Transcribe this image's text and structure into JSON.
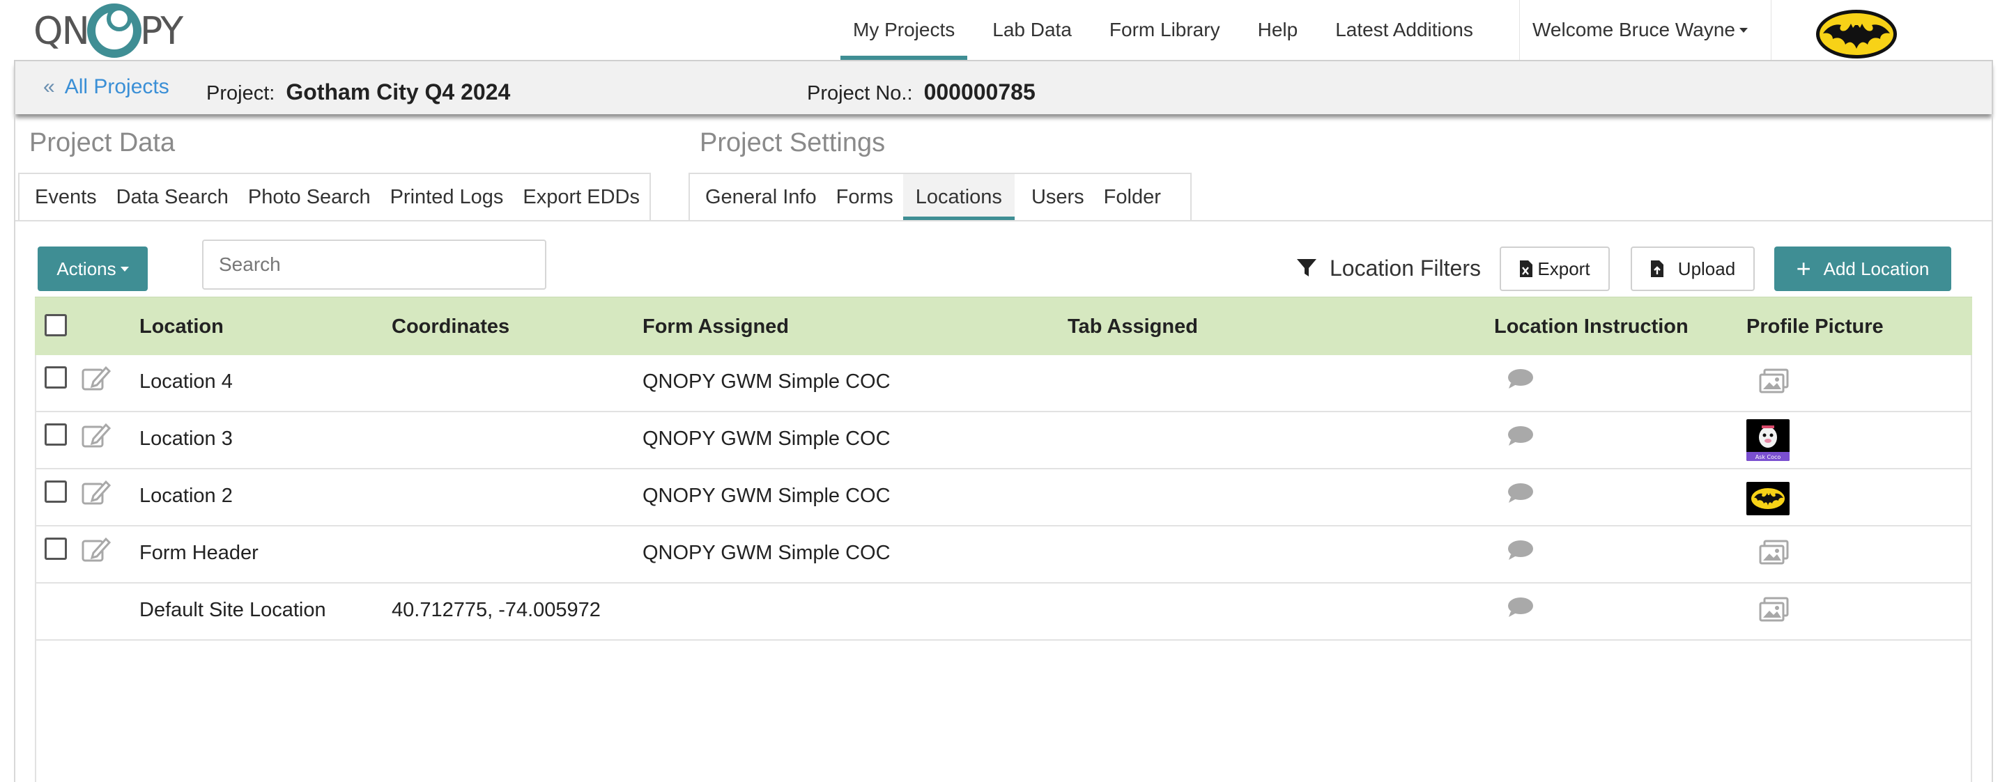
{
  "app": {
    "logo_text_left": "QN",
    "logo_text_right": "PY",
    "logo_color": "#3f8e94"
  },
  "nav": {
    "items": [
      {
        "label": "My Projects",
        "active": true
      },
      {
        "label": "Lab Data"
      },
      {
        "label": "Form Library"
      },
      {
        "label": "Help"
      },
      {
        "label": "Latest Additions"
      }
    ],
    "welcome": "Welcome Bruce Wayne",
    "avatar_icon": "batman-logo-icon"
  },
  "project": {
    "back_label": "All Projects",
    "project_label": "Project:",
    "project_name": "Gotham City Q4 2024",
    "number_label": "Project No.:",
    "number": "000000785"
  },
  "sections": {
    "data_title": "Project Data",
    "settings_title": "Project Settings",
    "data_tabs": [
      "Events",
      "Data Search",
      "Photo Search",
      "Printed Logs",
      "Export EDDs"
    ],
    "settings_tabs": [
      "General Info",
      "Forms",
      "Locations",
      "Users",
      "Folder"
    ],
    "active_settings_tab": "Locations"
  },
  "toolbar": {
    "actions_label": "Actions",
    "search_placeholder": "Search",
    "filters_label": "Location Filters",
    "export_label": "Export",
    "upload_label": "Upload",
    "add_label": "Add Location"
  },
  "table": {
    "headers": [
      "Location",
      "Coordinates",
      "Form Assigned",
      "Tab Assigned",
      "Location Instruction",
      "Profile Picture"
    ],
    "rows": [
      {
        "location": "Location 4",
        "coordinates": "",
        "form": "QNOPY GWM Simple COC",
        "tab": "",
        "picture": "placeholder"
      },
      {
        "location": "Location 3",
        "coordinates": "",
        "form": "QNOPY GWM Simple COC",
        "tab": "",
        "picture": "ask-coco",
        "thumb_caption": "Ask Coco"
      },
      {
        "location": "Location 2",
        "coordinates": "",
        "form": "QNOPY GWM Simple COC",
        "tab": "",
        "picture": "batman"
      },
      {
        "location": "Form Header",
        "coordinates": "",
        "form": "QNOPY GWM Simple COC",
        "tab": "",
        "picture": "placeholder"
      },
      {
        "location": "Default Site Location",
        "coordinates": "40.712775, -74.005972",
        "form": "",
        "tab": "",
        "picture": "placeholder"
      }
    ]
  },
  "colors": {
    "accent": "#3f8e94",
    "link": "#3a8fd6",
    "table_header": "#d6e8c0"
  }
}
